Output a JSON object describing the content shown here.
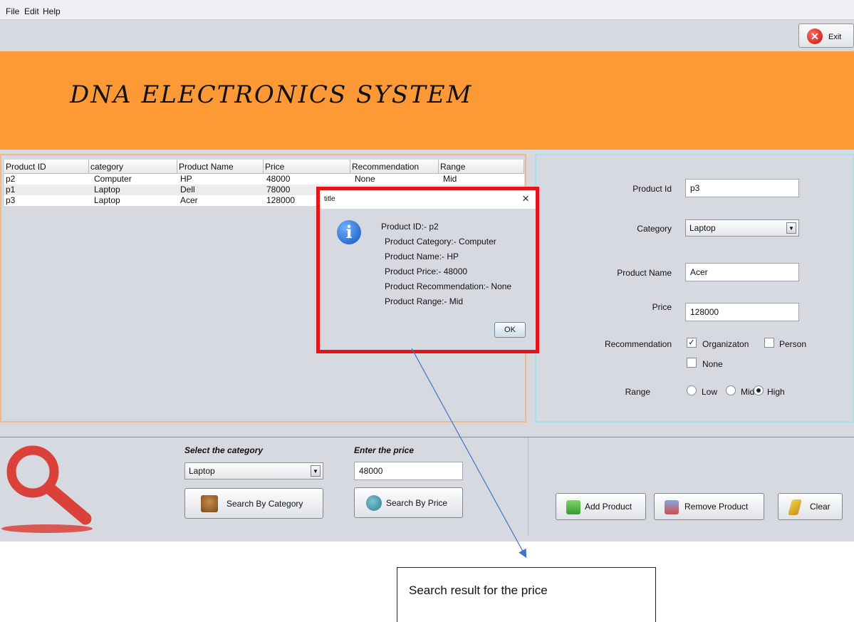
{
  "menu": [
    "File",
    "Edit",
    "Help"
  ],
  "exit_label": "Exit",
  "banner_title": "DNA ELECTRONICS SYSTEM",
  "table": {
    "columns": [
      "Product ID",
      "category",
      "Product Name",
      "Price",
      "Recommendation",
      "Range"
    ],
    "rows": [
      [
        "p2",
        "Computer",
        "HP",
        "48000",
        "None",
        "Mid"
      ],
      [
        "p1",
        "Laptop",
        "Dell",
        "78000",
        "",
        ""
      ],
      [
        "p3",
        "Laptop",
        "Acer",
        "128000",
        "",
        ""
      ]
    ]
  },
  "form": {
    "product_id_label": "Product Id",
    "product_id_value": "p3",
    "category_label": "Category",
    "category_value": "Laptop",
    "product_name_label": "Product Name",
    "product_name_value": "Acer",
    "price_label": "Price",
    "price_value": "128000",
    "recommendation_label": "Recommendation",
    "rec_options": [
      {
        "label": "Organizaton",
        "checked": true
      },
      {
        "label": "Person",
        "checked": false
      },
      {
        "label": "None",
        "checked": false
      }
    ],
    "range_label": "Range",
    "range_options": [
      {
        "label": "Low",
        "selected": false
      },
      {
        "label": "Mid",
        "selected": false
      },
      {
        "label": "High",
        "selected": true
      }
    ]
  },
  "search": {
    "category_heading": "Select the category",
    "category_value": "Laptop",
    "category_button": "Search By Category",
    "price_heading": "Enter the price",
    "price_value": "48000",
    "price_button": "Search By Price"
  },
  "actions": {
    "add": "Add Product",
    "remove": "Remove Product",
    "clear": "Clear"
  },
  "dialog": {
    "title": "title",
    "close": "×",
    "icon_letter": "i",
    "lines": [
      "Product ID:- p2",
      "Product Category:- Computer",
      "Product Name:- HP",
      "Product Price:- 48000",
      "Product Recommendation:- None",
      "Product Range:- Mid"
    ],
    "ok": "OK"
  },
  "annotation": "Search result for the price",
  "icons": {
    "exit": "close-circle-icon",
    "search_logo": "magnifier-icon",
    "category_btn": "teddy-bear-icon",
    "price_btn": "search-icon",
    "add": "bag-add-icon",
    "remove": "bag-remove-icon",
    "clear": "broom-icon",
    "info": "info-icon"
  },
  "colors": {
    "banner": "#fe9a36",
    "dialog_border": "#e3141b",
    "annotation_arrow": "#4472c4",
    "search_logo": "#d9413a"
  }
}
